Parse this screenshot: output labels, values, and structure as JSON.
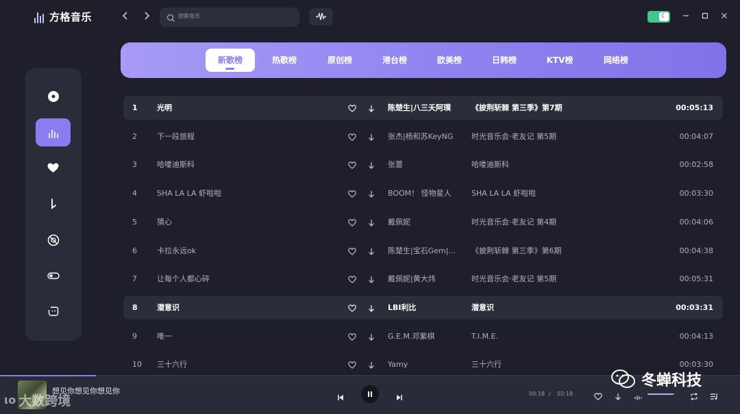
{
  "app": {
    "name": "方格音乐"
  },
  "search": {
    "placeholder": "搜索音乐"
  },
  "tabs": [
    {
      "label": "新歌榜",
      "active": true
    },
    {
      "label": "热歌榜",
      "active": false
    },
    {
      "label": "原创榜",
      "active": false
    },
    {
      "label": "港台榜",
      "active": false
    },
    {
      "label": "欧美榜",
      "active": false
    },
    {
      "label": "日韩榜",
      "active": false
    },
    {
      "label": "KTV榜",
      "active": false
    },
    {
      "label": "网络榜",
      "active": false
    }
  ],
  "sidebar": {
    "items": [
      {
        "icon": "disc-icon",
        "active": false
      },
      {
        "icon": "chart-bars-icon",
        "active": true
      },
      {
        "icon": "heart-icon",
        "active": false
      },
      {
        "icon": "download-icon",
        "active": false
      },
      {
        "icon": "vinyl-icon",
        "active": false
      },
      {
        "icon": "toggle-icon",
        "active": false
      },
      {
        "icon": "emoji-icon",
        "active": false
      }
    ]
  },
  "songs": [
    {
      "index": "1",
      "title": "光明",
      "artist": "陈楚生|八三夭阿璞",
      "album": "《披荆斩棘 第三季》第7期",
      "duration": "00:05:13",
      "highlighted": true
    },
    {
      "index": "2",
      "title": "下一段旅程",
      "artist": "张杰|杨和苏KeyNG",
      "album": "时光音乐会·老友记 第5期",
      "duration": "00:04:07",
      "highlighted": false
    },
    {
      "index": "3",
      "title": "哈喽迪斯科",
      "artist": "张蔷",
      "album": "哈喽迪斯科",
      "duration": "00:02:58",
      "highlighted": false
    },
    {
      "index": "4",
      "title": "SHA LA LA 虾啦啦",
      "artist": "BOOM！ 怪物星人",
      "album": "SHA LA LA 虾啦啦",
      "duration": "00:03:30",
      "highlighted": false
    },
    {
      "index": "5",
      "title": "猜心",
      "artist": "戴佩妮",
      "album": "时光音乐会·老友记 第4期",
      "duration": "00:04:06",
      "highlighted": false
    },
    {
      "index": "6",
      "title": "卡拉永远ok",
      "artist": "陈楚生|宝石Gem|...",
      "album": "《披荆斩棘 第三季》第6期",
      "duration": "00:04:38",
      "highlighted": false
    },
    {
      "index": "7",
      "title": "让每个人都心碎",
      "artist": "戴佩妮|黄大炜",
      "album": "时光音乐会·老友记 第5期",
      "duration": "00:05:31",
      "highlighted": false
    },
    {
      "index": "8",
      "title": "潜意识",
      "artist": "LBI利比",
      "album": "潜意识",
      "duration": "00:03:31",
      "highlighted": true
    },
    {
      "index": "9",
      "title": "唯一",
      "artist": "G.E.M.邓紫棋",
      "album": "T.I.M.E.",
      "duration": "00:04:13",
      "highlighted": false
    },
    {
      "index": "10",
      "title": "三十六行",
      "artist": "Yamy",
      "album": "三十六行",
      "duration": "00:03:30",
      "highlighted": false
    }
  ],
  "player": {
    "title": "想见你想见你想见你",
    "current_time": "00:18",
    "separator": "/",
    "total_time": "02:18",
    "progress": 0.13,
    "volume": 0.95
  },
  "watermarks": {
    "right": "冬蝉科技",
    "left": "大数跨境"
  }
}
